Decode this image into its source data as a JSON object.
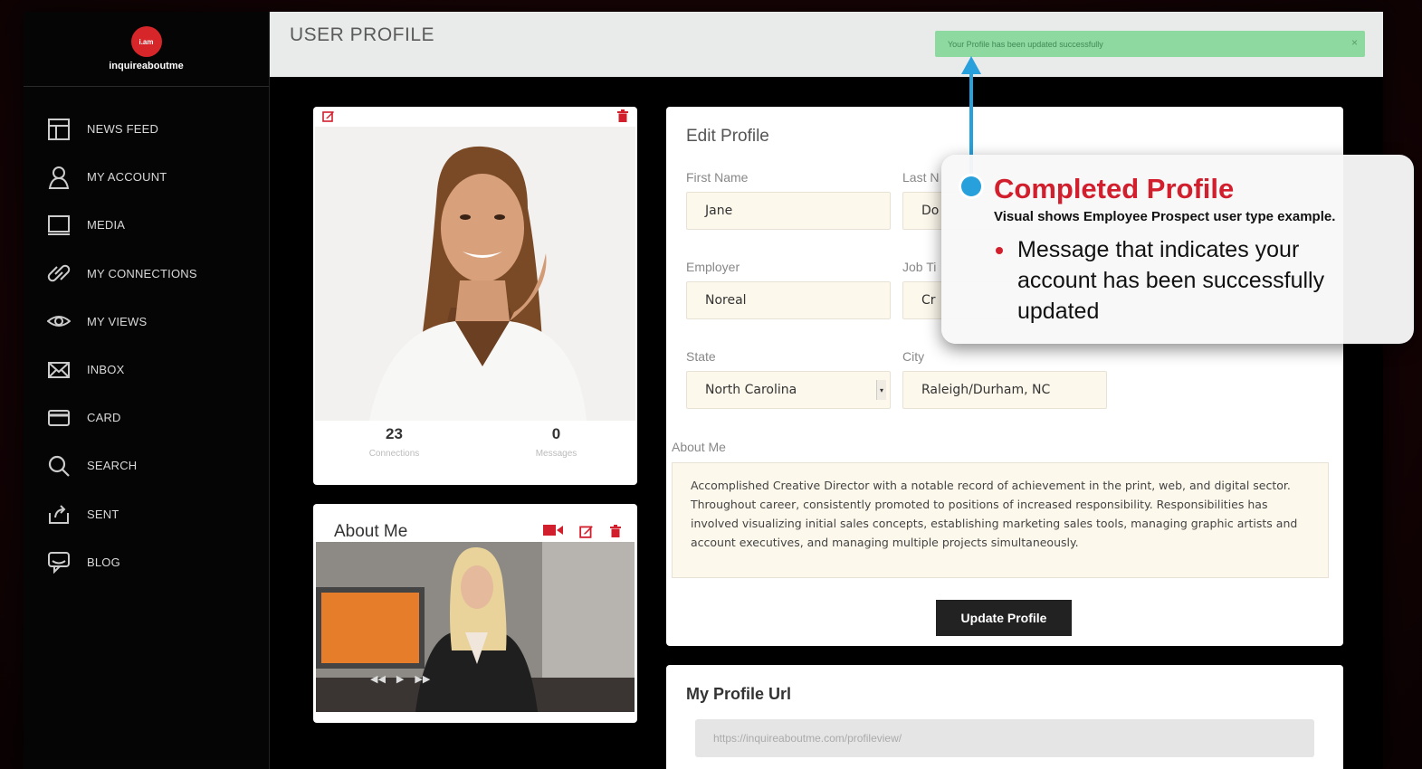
{
  "brand": {
    "logo_text": "i.am",
    "name": "inquireaboutme"
  },
  "sidebar": {
    "items": [
      {
        "label": "NEWS FEED",
        "icon": "newsfeed-icon"
      },
      {
        "label": "MY ACCOUNT",
        "icon": "user-icon"
      },
      {
        "label": "MEDIA",
        "icon": "monitor-icon"
      },
      {
        "label": "MY CONNECTIONS",
        "icon": "link-icon"
      },
      {
        "label": "MY VIEWS",
        "icon": "eye-icon"
      },
      {
        "label": "INBOX",
        "icon": "envelope-icon"
      },
      {
        "label": "CARD",
        "icon": "card-icon"
      },
      {
        "label": "SEARCH",
        "icon": "search-icon"
      },
      {
        "label": "SENT",
        "icon": "share-icon"
      },
      {
        "label": "BLOG",
        "icon": "chat-icon"
      }
    ]
  },
  "header": {
    "title": "USER PROFILE",
    "alert": "Your Profile has been updated successfully",
    "alert_close": "×"
  },
  "profile": {
    "connections_count": "23",
    "connections_label": "Connections",
    "messages_count": "0",
    "messages_label": "Messages"
  },
  "about_card": {
    "title": "About Me"
  },
  "edit_profile": {
    "title": "Edit Profile",
    "first_name_label": "First Name",
    "first_name": "Jane",
    "last_name_label": "Last N",
    "last_name": "Do",
    "employer_label": "Employer",
    "employer": "Noreal",
    "job_title_label": "Job Ti",
    "job_title": "Cr",
    "state_label": "State",
    "state": "North Carolina",
    "city_label": "City",
    "city": "Raleigh/Durham, NC",
    "about_label": "About Me",
    "about_text": "Accomplished Creative Director with a notable record of achievement in the print, web, and digital sector. Throughout career, consistently promoted to positions of increased responsibility. Responsibilities has involved visualizing initial sales concepts, establishing marketing sales tools, managing graphic artists and account executives, and managing multiple projects simultaneously.",
    "update_button": "Update Profile"
  },
  "profile_url": {
    "title": "My Profile Url",
    "value": "https://inquireaboutme.com/profileview/"
  },
  "callout": {
    "title": "Completed Profile",
    "subtitle": "Visual shows Employee Prospect user type example.",
    "bullet": "Message that indicates your account has been successfully updated"
  },
  "colors": {
    "accent_red": "#d11f2e",
    "arrow_blue": "#27a0dc",
    "alert_green": "#8ed9a0"
  }
}
